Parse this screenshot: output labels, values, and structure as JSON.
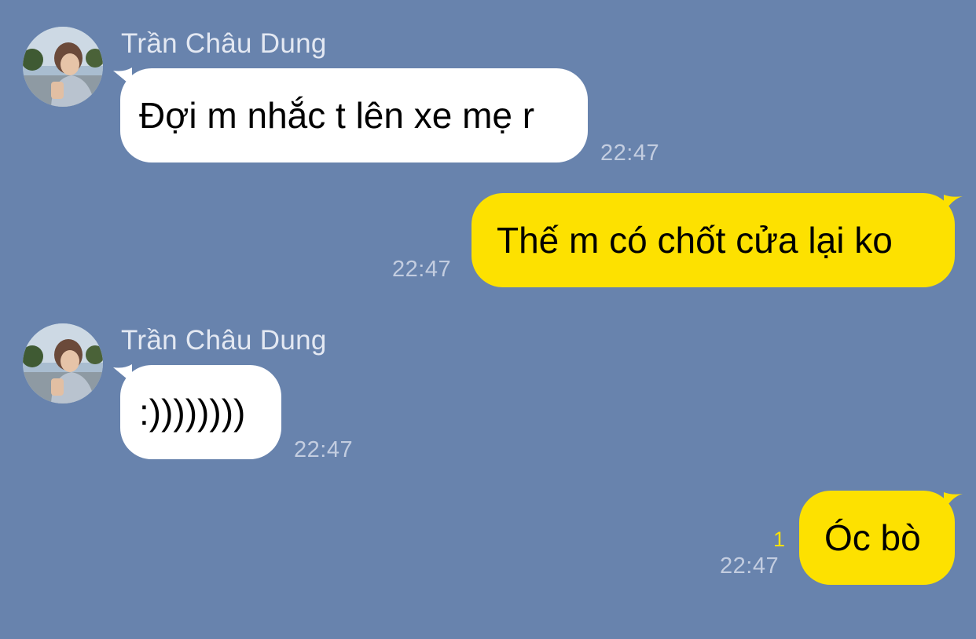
{
  "colors": {
    "background": "#6883ad",
    "incoming_bubble": "#ffffff",
    "outgoing_bubble": "#fde100",
    "timestamp": "#c3cde0",
    "sender_name": "#e3e8f2",
    "read_count": "#fde100"
  },
  "messages": [
    {
      "direction": "incoming",
      "sender": "Trần Châu Dung",
      "avatar_icon": "profile-photo-avatar",
      "text": "Đợi m nhắc t lên xe mẹ r",
      "time": "22:47"
    },
    {
      "direction": "outgoing",
      "text": "Thế m có chốt cửa lại ko",
      "time": "22:47"
    },
    {
      "direction": "incoming",
      "sender": "Trần Châu Dung",
      "avatar_icon": "profile-photo-avatar",
      "text": ":))))))))",
      "time": "22:47"
    },
    {
      "direction": "outgoing",
      "text": "Óc bò",
      "time": "22:47",
      "unread_count": "1"
    }
  ]
}
